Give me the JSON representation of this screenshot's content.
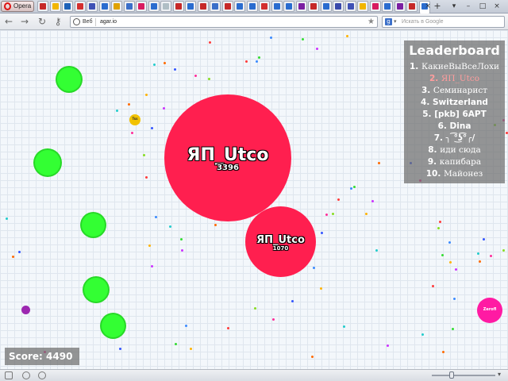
{
  "browser": {
    "menu_label": "Opera",
    "tabs": [
      {
        "icon": "tab-favicon",
        "color": "#c62828"
      },
      {
        "icon": "tab-favicon",
        "color": "#f2b600"
      },
      {
        "icon": "tab-favicon",
        "color": "#1e63b8"
      },
      {
        "icon": "tab-favicon",
        "color": "#d32f2f"
      },
      {
        "icon": "tab-favicon",
        "color": "#3f51b5"
      },
      {
        "icon": "tab-favicon",
        "color": "#2a6ccf"
      },
      {
        "icon": "tab-favicon",
        "color": "#e0a200"
      },
      {
        "icon": "tab-favicon",
        "color": "#3b6fc9"
      },
      {
        "icon": "tab-favicon",
        "color": "#d81b60"
      },
      {
        "icon": "tab-favicon",
        "color": "#2a6ccf"
      },
      {
        "icon": "tab-favicon",
        "color": "#b0bec5"
      },
      {
        "icon": "tab-favicon",
        "color": "#c62828"
      },
      {
        "icon": "tab-favicon",
        "color": "#2a6ccf"
      },
      {
        "icon": "tab-favicon",
        "color": "#c62828"
      },
      {
        "icon": "tab-favicon",
        "color": "#3b6fc9"
      },
      {
        "icon": "tab-favicon",
        "color": "#c62828"
      },
      {
        "icon": "tab-favicon",
        "color": "#2a6ccf"
      },
      {
        "icon": "tab-favicon",
        "color": "#2a6ccf"
      },
      {
        "icon": "tab-favicon",
        "color": "#d32f2f"
      },
      {
        "icon": "tab-favicon",
        "color": "#2a6ccf"
      },
      {
        "icon": "tab-favicon",
        "color": "#2a6ccf"
      },
      {
        "icon": "tab-favicon",
        "color": "#7b1fa2"
      },
      {
        "icon": "tab-favicon",
        "color": "#c62828"
      },
      {
        "icon": "tab-favicon",
        "color": "#2a6ccf"
      },
      {
        "icon": "tab-favicon",
        "color": "#3949ab"
      },
      {
        "icon": "tab-favicon",
        "color": "#3f51b5"
      },
      {
        "icon": "tab-favicon",
        "color": "#f2b600"
      },
      {
        "icon": "tab-favicon",
        "color": "#d81b60"
      },
      {
        "icon": "tab-favicon",
        "color": "#2a6ccf"
      },
      {
        "icon": "tab-favicon",
        "color": "#7b1fa2"
      },
      {
        "icon": "tab-favicon",
        "color": "#c62828"
      },
      {
        "icon": "tab-favicon",
        "color": "#2a6ccf"
      }
    ],
    "close_tab_glyph": "×",
    "new_tab_glyph": "+",
    "window_controls": [
      "▾",
      "–",
      "□",
      "×"
    ],
    "nav": {
      "back": "←",
      "forward": "→",
      "reload": "↻",
      "key": "⚷"
    },
    "address": {
      "site_label": "Веб",
      "url": "agar.io",
      "star": "★"
    },
    "search": {
      "engine_letter": "g",
      "caret": "▾",
      "placeholder": "Искать в Google"
    }
  },
  "game": {
    "colors": {
      "player": "#ff1f4f",
      "virus": "#33ff33",
      "virus_border": "#27d927",
      "leaderboard_me": "#ff9d9d"
    },
    "player_cells": [
      {
        "name": "ЯП_Utco",
        "mass": "3396"
      },
      {
        "name": "ЯП_Utco",
        "mass": "1070"
      }
    ],
    "other_cells": [
      {
        "name": "Tss",
        "color": "#f2c200"
      },
      {
        "name": "Zerofl",
        "color": "#ff1aa3"
      },
      {
        "name": "",
        "color": "#9c27b0"
      }
    ],
    "viruses": 5,
    "leaderboard": {
      "title": "Leaderboard",
      "entries": [
        {
          "rank": "1.",
          "name": "КакиеВыВсеЛохи",
          "me": false
        },
        {
          "rank": "2.",
          "name": "ЯП_Utco",
          "me": true
        },
        {
          "rank": "3.",
          "name": "Семинарист",
          "me": false
        },
        {
          "rank": "4.",
          "name": "Switzerland",
          "me": false
        },
        {
          "rank": "5.",
          "name": "[pkb] 6APT",
          "me": false
        },
        {
          "rank": "6.",
          "name": "Dina",
          "me": false
        },
        {
          "rank": "7.",
          "name": "╮ ͡°͜ʖ͡°╭/",
          "me": false
        },
        {
          "rank": "8.",
          "name": "иди сюда",
          "me": false
        },
        {
          "rank": "9.",
          "name": "капибара",
          "me": false
        },
        {
          "rank": "10.",
          "name": "Майонез",
          "me": false
        }
      ]
    },
    "score_label": "Score: 4490"
  }
}
